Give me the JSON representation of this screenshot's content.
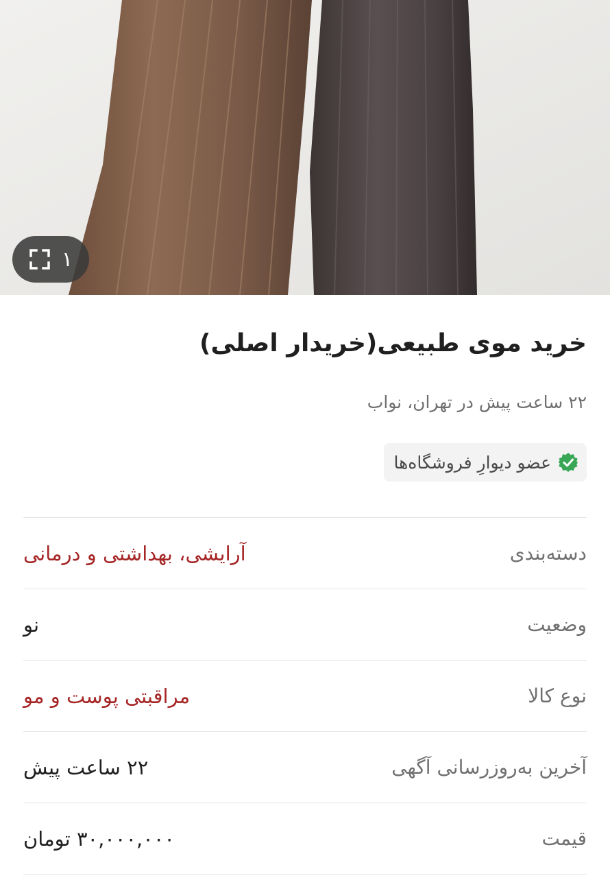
{
  "gallery": {
    "image_alt": "natural hair photo",
    "count": "۱",
    "expand_icon": "expand-icon"
  },
  "listing": {
    "title": "خرید موی طبیعی(خریدار اصلی)",
    "meta": "۲۲ ساعت پیش در تهران، نواب",
    "badge": {
      "icon": "verified-check-icon",
      "label": "عضو دیوارِ فروشگاه‌ها"
    }
  },
  "details": [
    {
      "label": "دسته‌بندی",
      "value": "آرایشی، بهداشتی و درمانی",
      "is_link": true
    },
    {
      "label": "وضعیت",
      "value": "نو",
      "is_link": false
    },
    {
      "label": "نوع کالا",
      "value": "مراقبتی پوست و مو",
      "is_link": true
    },
    {
      "label": "آخرین به‌روزرسانی آگهی",
      "value": "۲۲ ساعت پیش",
      "is_link": false
    },
    {
      "label": "قیمت",
      "value": "۳۰,۰۰۰,۰۰۰ تومان",
      "is_link": false
    }
  ],
  "colors": {
    "link": "#a62626",
    "badge_check": "#3aa757",
    "label": "#707070",
    "value": "#1f1f1f"
  }
}
